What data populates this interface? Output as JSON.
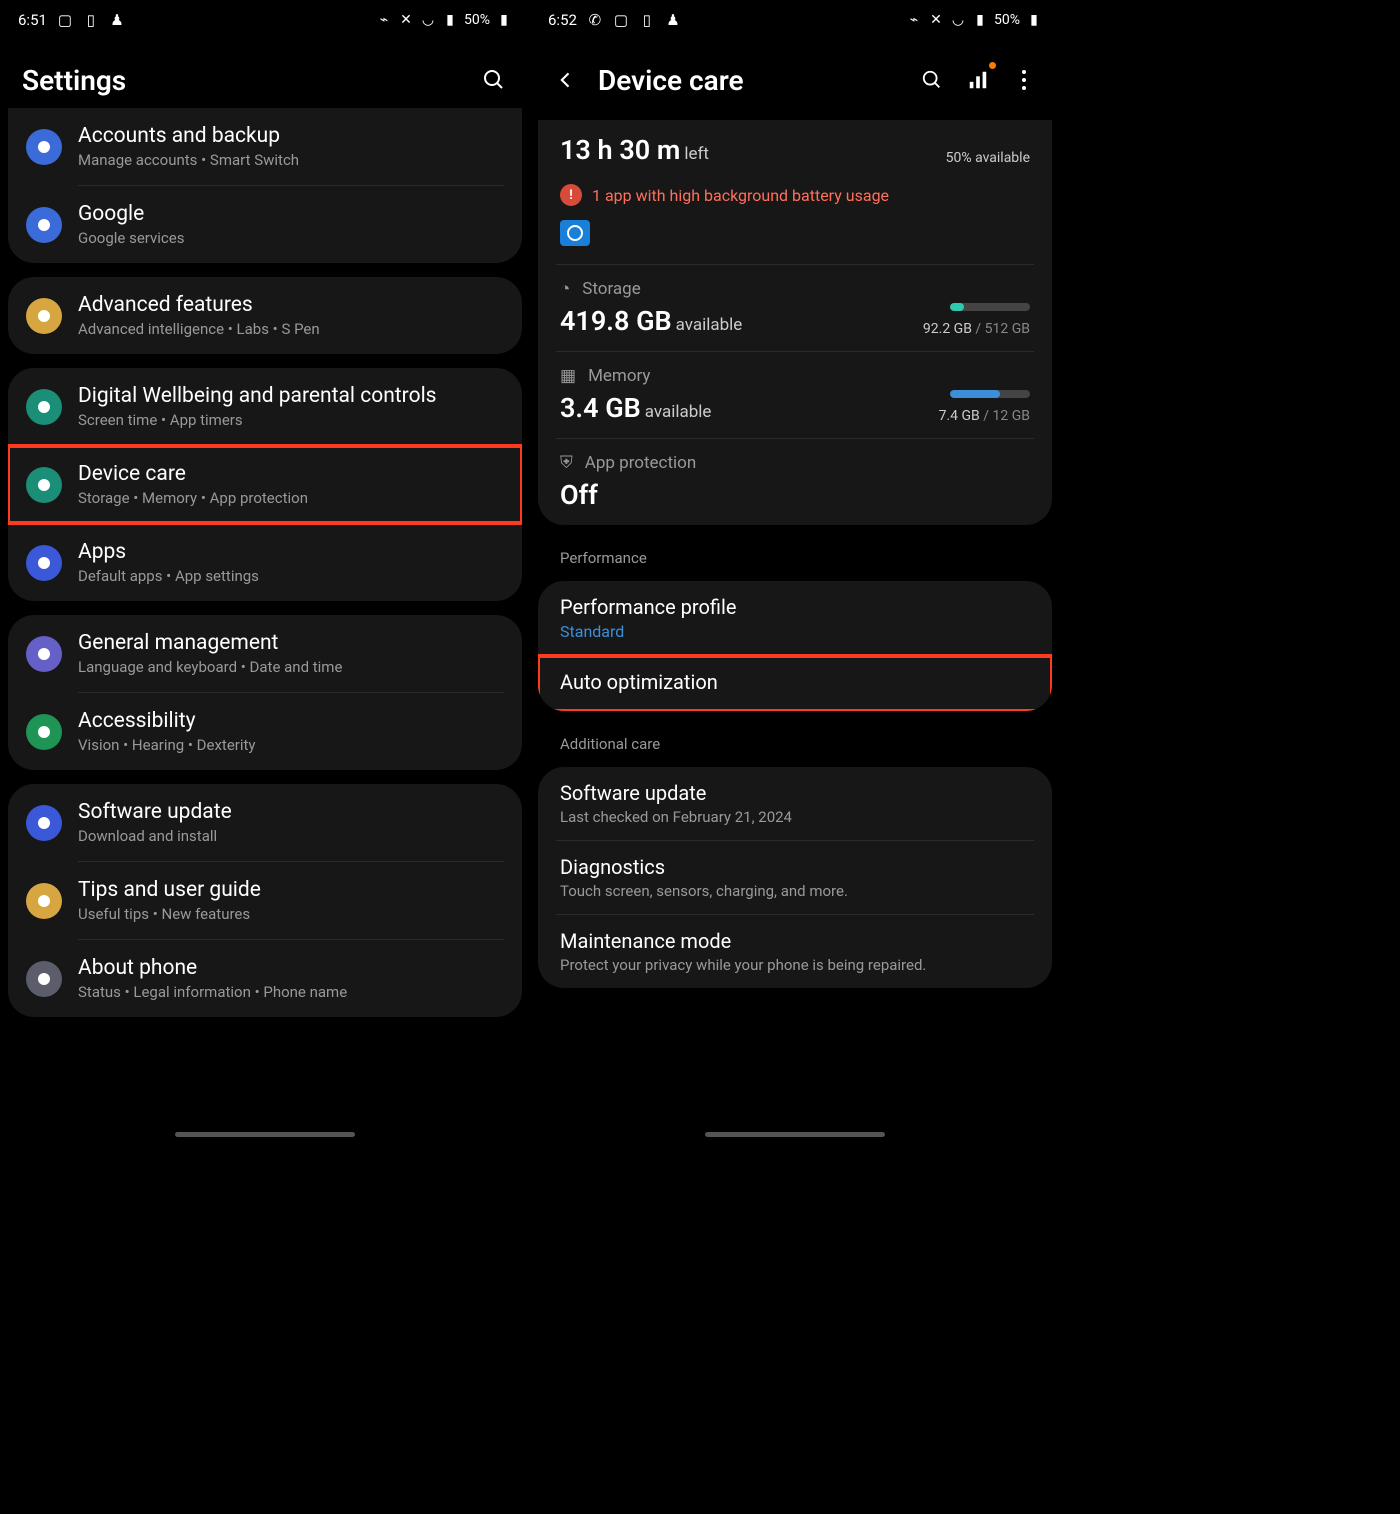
{
  "left": {
    "status": {
      "time": "6:51",
      "battery": "50%"
    },
    "header": {
      "title": "Settings"
    },
    "groups": [
      {
        "items": [
          {
            "title": "Accounts and backup",
            "sub": "Manage accounts  •  Smart Switch",
            "icon": "sync-icon",
            "iclass": "ic-blue"
          },
          {
            "title": "Google",
            "sub": "Google services",
            "icon": "google-icon",
            "iclass": "ic-blue"
          }
        ]
      },
      {
        "items": [
          {
            "title": "Advanced features",
            "sub": "Advanced intelligence  •  Labs  •  S Pen",
            "icon": "gear-icon",
            "iclass": "ic-orange"
          }
        ]
      },
      {
        "items": [
          {
            "title": "Digital Wellbeing and parental controls",
            "sub": "Screen time  •  App timers",
            "icon": "heart-icon",
            "iclass": "ic-teal"
          },
          {
            "title": "Device care",
            "sub": "Storage  •  Memory  •  App protection",
            "icon": "devicecare-icon",
            "iclass": "ic-teal",
            "highlight": true
          },
          {
            "title": "Apps",
            "sub": "Default apps  •  App settings",
            "icon": "apps-icon",
            "iclass": "ic-blue2"
          }
        ]
      },
      {
        "items": [
          {
            "title": "General management",
            "sub": "Language and keyboard  •  Date and time",
            "icon": "sliders-icon",
            "iclass": "ic-purple"
          },
          {
            "title": "Accessibility",
            "sub": "Vision  •  Hearing  •  Dexterity",
            "icon": "accessibility-icon",
            "iclass": "ic-green"
          }
        ]
      },
      {
        "items": [
          {
            "title": "Software update",
            "sub": "Download and install",
            "icon": "update-icon",
            "iclass": "ic-blue2"
          },
          {
            "title": "Tips and user guide",
            "sub": "Useful tips  •  New features",
            "icon": "bulb-icon",
            "iclass": "ic-yellow"
          },
          {
            "title": "About phone",
            "sub": "Status  •  Legal information  •  Phone name",
            "icon": "info-icon",
            "iclass": "ic-gray"
          }
        ]
      }
    ]
  },
  "right": {
    "status": {
      "time": "6:52",
      "battery": "50%"
    },
    "header": {
      "title": "Device care"
    },
    "battery": {
      "time": "13 h 30 m",
      "suffix": "left",
      "available": "50% available",
      "alert": "1 app with high background battery usage"
    },
    "storage": {
      "label": "Storage",
      "value": "419.8 GB",
      "suffix": "available",
      "used": "92.2 GB",
      "total": "512 GB",
      "pct": 18,
      "color": "#2dc9b0"
    },
    "memory": {
      "label": "Memory",
      "value": "3.4 GB",
      "suffix": "available",
      "used": "7.4 GB",
      "total": "12 GB",
      "pct": 62,
      "color": "#3a8fd8"
    },
    "protection": {
      "label": "App protection",
      "value": "Off"
    },
    "sections": {
      "performance": {
        "header": "Performance",
        "items": [
          {
            "title": "Performance profile",
            "sub": "Standard"
          },
          {
            "title": "Auto optimization",
            "highlight": true
          }
        ]
      },
      "additional": {
        "header": "Additional care",
        "items": [
          {
            "title": "Software update",
            "sub": "Last checked on February 21, 2024"
          },
          {
            "title": "Diagnostics",
            "sub": "Touch screen, sensors, charging, and more."
          },
          {
            "title": "Maintenance mode",
            "sub": "Protect your privacy while your phone is being repaired."
          }
        ]
      }
    }
  }
}
